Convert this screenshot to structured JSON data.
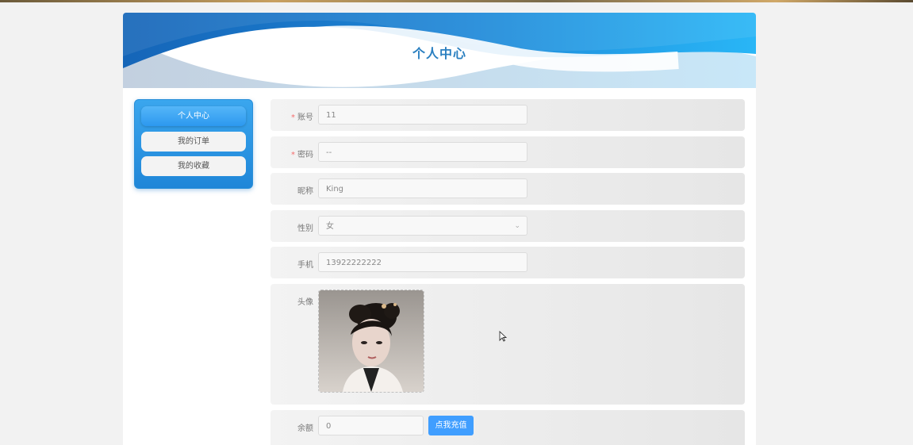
{
  "header": {
    "title": "个人中心"
  },
  "sidebar": {
    "items": [
      {
        "label": "个人中心",
        "active": true
      },
      {
        "label": "我的订单",
        "active": false
      },
      {
        "label": "我的收藏",
        "active": false
      }
    ]
  },
  "form": {
    "account": {
      "label": "账号",
      "value": "11",
      "required": true
    },
    "password": {
      "label": "密码",
      "value": "--",
      "required": true
    },
    "nickname": {
      "label": "昵称",
      "value": "King"
    },
    "gender": {
      "label": "性别",
      "value": "女"
    },
    "phone": {
      "label": "手机",
      "value": "13922222222"
    },
    "avatar": {
      "label": "头像"
    },
    "balance": {
      "label": "余额",
      "value": "0",
      "button_label": "点我充值"
    }
  },
  "colors": {
    "accent": "#409eff",
    "banner_dark": "#1565b8",
    "banner_light": "#29b6f6",
    "title": "#2a7fc0",
    "required": "#f56c6c"
  }
}
